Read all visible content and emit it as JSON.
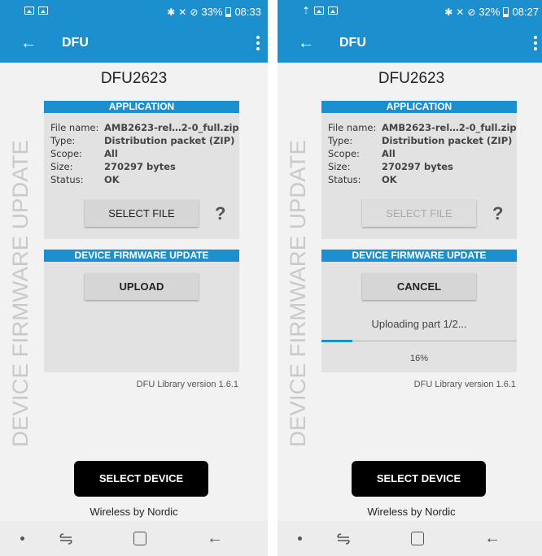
{
  "screens": [
    {
      "status_battery": "33%",
      "status_time": "08:33",
      "app_title": "DFU",
      "vertical_label": "DEVICE FIRMWARE UPDATE",
      "device_name": "DFU2623",
      "application_header": "APPLICATION",
      "file_info": {
        "file_name_label": "File name:",
        "file_name": "AMB2623-rel…2-0_full.zip",
        "type_label": "Type:",
        "type": "Distribution packet (ZIP)",
        "scope_label": "Scope:",
        "scope": "All",
        "size_label": "Size:",
        "size": "270297 bytes",
        "status_label": "Status:",
        "status": "OK"
      },
      "select_file_label": "SELECT FILE",
      "select_file_enabled": true,
      "help_label": "?",
      "dfu_header": "DEVICE FIRMWARE UPDATE",
      "action_label": "UPLOAD",
      "library_version": "DFU Library version 1.6.1",
      "select_device_label": "SELECT DEVICE",
      "footer_text": "Wireless by Nordic"
    },
    {
      "status_battery": "32%",
      "status_time": "08:27",
      "app_title": "DFU",
      "vertical_label": "DEVICE FIRMWARE UPDATE",
      "device_name": "DFU2623",
      "application_header": "APPLICATION",
      "file_info": {
        "file_name_label": "File name:",
        "file_name": "AMB2623-rel…2-0_full.zip",
        "type_label": "Type:",
        "type": "Distribution packet (ZIP)",
        "scope_label": "Scope:",
        "scope": "All",
        "size_label": "Size:",
        "size": "270297 bytes",
        "status_label": "Status:",
        "status": "OK"
      },
      "select_file_label": "SELECT FILE",
      "select_file_enabled": false,
      "help_label": "?",
      "dfu_header": "DEVICE FIRMWARE UPDATE",
      "action_label": "CANCEL",
      "upload_status": "Uploading part 1/2...",
      "progress_percent_text": "16%",
      "progress_fraction": 0.16,
      "library_version": "DFU Library version 1.6.1",
      "select_device_label": "SELECT DEVICE",
      "footer_text": "Wireless by Nordic"
    }
  ],
  "colors": {
    "accent": "#1c8fcf",
    "background": "#f2f2f2",
    "panel": "#e2e2e2",
    "vertical_label": "#c9c9c9"
  }
}
